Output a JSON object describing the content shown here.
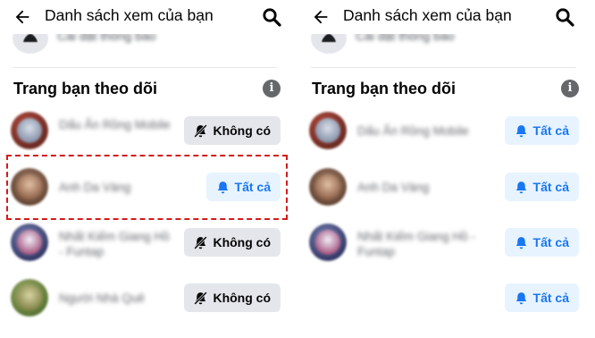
{
  "colors": {
    "accent_blue": "#1877f2",
    "active_button_bg": "#e7f3ff",
    "inactive_button_bg": "#e4e6eb",
    "highlight_dashed": "#d21b1b"
  },
  "panels": [
    {
      "header": {
        "title": "Danh sách xem của bạn",
        "back_icon": "back-arrow-icon",
        "search_icon": "search-icon"
      },
      "previous_item": {
        "text": "Cài đặt thông báo"
      },
      "section_title": "Trang bạn theo dõi",
      "info_icon": {
        "symbol": "i"
      },
      "pages": [
        {
          "name": "Dấu Ấn Rồng Mobile",
          "notification": "Không có",
          "state": "off"
        },
        {
          "name": "Anh Da Vàng",
          "notification": "Tất cả",
          "state": "on"
        },
        {
          "name": "Nhất Kiếm Giang Hồ - Funtap",
          "notification": "Không có",
          "state": "off"
        },
        {
          "name": "Người Nhà Quê",
          "notification": "Không có",
          "state": "off"
        }
      ]
    },
    {
      "header": {
        "title": "Danh sách xem của bạn",
        "back_icon": "back-arrow-icon",
        "search_icon": "search-icon"
      },
      "previous_item": {
        "text": "Cài đặt thông báo"
      },
      "section_title": "Trang bạn theo dõi",
      "info_icon": {
        "symbol": "i"
      },
      "pages": [
        {
          "name": "Dấu Ấn Rồng Mobile",
          "notification": "Tất cả",
          "state": "on"
        },
        {
          "name": "Anh Da Vàng",
          "notification": "Tất cả",
          "state": "on"
        },
        {
          "name": "Nhất Kiếm Giang Hồ - Funtap",
          "notification": "Tất cả",
          "state": "on"
        },
        {
          "name": "",
          "notification": "Tất cả",
          "state": "on"
        }
      ]
    }
  ]
}
